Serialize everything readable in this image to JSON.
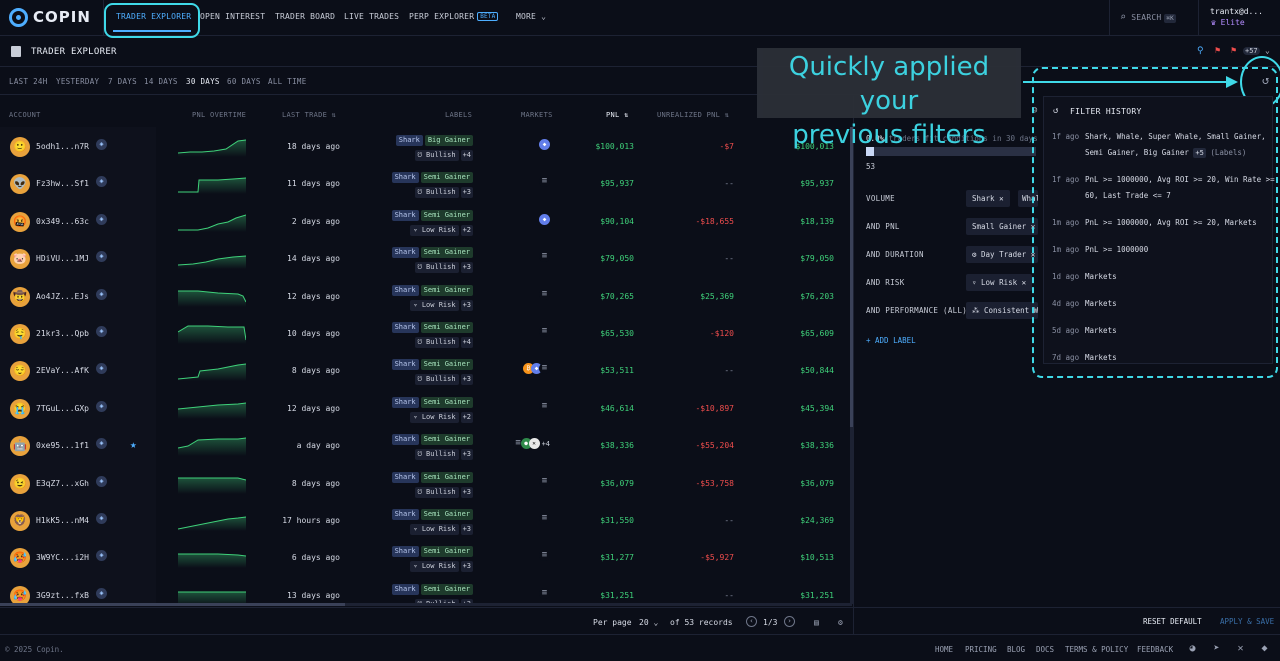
{
  "nav": {
    "logo": "COPIN",
    "items": [
      "TRADER EXPLORER",
      "OPEN INTEREST",
      "TRADER BOARD",
      "LIVE TRADES",
      "PERP EXPLORER"
    ],
    "beta": "BETA",
    "more": "MORE",
    "search": "SEARCH",
    "search_kbd": "⌘K",
    "user": "trantx@d...",
    "tier": "Elite"
  },
  "subheader": {
    "title": "TRADER EXPLORER",
    "count_badge": "+57"
  },
  "timeframes": [
    "LAST 24H",
    "YESTERDAY",
    "7 DAYS",
    "14 DAYS",
    "30 DAYS",
    "60 DAYS",
    "ALL TIME"
  ],
  "active_timeframe": "30 DAYS",
  "columns": {
    "account": "ACCOUNT",
    "pnl_overtime": "PNL OVERTIME",
    "last_trade": "LAST TRADE",
    "labels": "LABELS",
    "markets": "MARKETS",
    "pnl": "PNL",
    "unrealized_pnl": "UNREALIZED PNL"
  },
  "rows": [
    {
      "avatar": "🙂",
      "addr": "5odh1...n7R",
      "last": "18 days ago",
      "l1": [
        "Shark",
        "Big Gainer"
      ],
      "l2": [
        "Bullish"
      ],
      "plus": "+4",
      "markets": [
        "eth"
      ],
      "pnl": "$100,013",
      "upnl": "-$7",
      "upnl_cls": "neg",
      "total": "$100,013",
      "spark": "0,18 12,17 24,17 36,16 48,14 60,6 68,5"
    },
    {
      "avatar": "👽",
      "addr": "Fz3hw...Sf1",
      "last": "11 days ago",
      "l1": [
        "Shark",
        "Semi Gainer"
      ],
      "l2": [
        "Bullish"
      ],
      "plus": "+3",
      "markets": [
        "list"
      ],
      "pnl": "$95,937",
      "upnl": "--",
      "upnl_cls": "neu",
      "total": "$95,937",
      "spark": "0,20 20,20 21,8 40,8 55,7 68,6"
    },
    {
      "avatar": "🤬",
      "addr": "0x349...63c",
      "last": "2 days ago",
      "l1": [
        "Shark",
        "Semi Gainer"
      ],
      "l2": [
        "Low Risk"
      ],
      "plus": "+2",
      "markets": [
        "eth"
      ],
      "pnl": "$90,104",
      "upnl": "-$18,655",
      "upnl_cls": "neg",
      "total": "$18,139",
      "spark": "0,20 20,20 30,18 40,14 50,12 58,8 68,5"
    },
    {
      "avatar": "🐷",
      "addr": "HDiVU...1MJ",
      "last": "14 days ago",
      "l1": [
        "Shark",
        "Semi Gainer"
      ],
      "l2": [
        "Bullish"
      ],
      "plus": "+3",
      "markets": [
        "list"
      ],
      "pnl": "$79,050",
      "upnl": "--",
      "upnl_cls": "neu",
      "total": "$79,050",
      "spark": "0,18 15,17 28,15 40,12 55,10 68,9"
    },
    {
      "avatar": "🤠",
      "addr": "Ao4JZ...EJs",
      "last": "12 days ago",
      "l1": [
        "Shark",
        "Semi Gainer"
      ],
      "l2": [
        "Low Risk"
      ],
      "plus": "+3",
      "markets": [
        "list"
      ],
      "pnl": "$70,265",
      "upnl": "$25,369",
      "upnl_cls": "pos",
      "total": "$76,203",
      "spark": "0,6 20,6 40,8 60,9 65,11 68,17"
    },
    {
      "avatar": "🤤",
      "addr": "21kr3...Qpb",
      "last": "10 days ago",
      "l1": [
        "Shark",
        "Semi Gainer"
      ],
      "l2": [
        "Bullish"
      ],
      "plus": "+4",
      "markets": [
        "list"
      ],
      "pnl": "$65,530",
      "upnl": "-$120",
      "upnl_cls": "neg",
      "total": "$65,609",
      "spark": "0,10 10,4 30,4 50,5 66,5 68,18"
    },
    {
      "avatar": "😌",
      "addr": "2EVaY...AfK",
      "last": "8 days ago",
      "l1": [
        "Shark",
        "Semi Gainer"
      ],
      "l2": [
        "Bullish"
      ],
      "plus": "+3",
      "markets": [
        "btc",
        "eth",
        "list"
      ],
      "pnl": "$53,511",
      "upnl": "--",
      "upnl_cls": "neu",
      "total": "$50,844",
      "spark": "0,20 20,18 22,12 40,10 50,8 60,6 68,5"
    },
    {
      "avatar": "😭",
      "addr": "7TGuL...GXp",
      "last": "12 days ago",
      "l1": [
        "Shark",
        "Semi Gainer"
      ],
      "l2": [
        "Low Risk"
      ],
      "plus": "+2",
      "markets": [
        "list"
      ],
      "pnl": "$46,614",
      "upnl": "-$10,897",
      "upnl_cls": "neg",
      "total": "$45,394",
      "spark": "0,12 20,10 40,8 60,7 68,6"
    },
    {
      "avatar": "🤖",
      "addr": "0xe95...1f1",
      "last": "a day ago",
      "l1": [
        "Shark",
        "Semi Gainer"
      ],
      "l2": [
        "Bullish"
      ],
      "plus": "+3",
      "markets": [
        "list",
        "gr",
        "x"
      ],
      "mplus": "+4",
      "pnl": "$38,336",
      "upnl": "-$55,204",
      "upnl_cls": "neg",
      "total": "$38,336",
      "star": true,
      "spark": "0,14 10,12 20,6 40,5 60,5 68,4"
    },
    {
      "avatar": "😉",
      "addr": "E3qZ7...xGh",
      "last": "8 days ago",
      "l1": [
        "Shark",
        "Semi Gainer"
      ],
      "l2": [
        "Bullish"
      ],
      "plus": "+3",
      "markets": [
        "list"
      ],
      "pnl": "$36,079",
      "upnl": "-$53,758",
      "upnl_cls": "neg",
      "total": "$36,079",
      "spark": "0,6 20,6 40,6 60,6 68,8"
    },
    {
      "avatar": "🦁",
      "addr": "H1kK5...nM4",
      "last": "17 hours ago",
      "l1": [
        "Shark",
        "Semi Gainer"
      ],
      "l2": [
        "Low Risk"
      ],
      "plus": "+3",
      "markets": [
        "list"
      ],
      "pnl": "$31,550",
      "upnl": "--",
      "upnl_cls": "neu",
      "total": "$24,369",
      "spark": "0,20 10,18 20,16 30,14 40,12 50,10 60,9 68,8"
    },
    {
      "avatar": "🥵",
      "addr": "3W9YC...i2H",
      "last": "6 days ago",
      "l1": [
        "Shark",
        "Semi Gainer"
      ],
      "l2": [
        "Low Risk"
      ],
      "plus": "+3",
      "markets": [
        "list"
      ],
      "pnl": "$31,277",
      "upnl": "-$5,927",
      "upnl_cls": "neg",
      "total": "$10,513",
      "spark": "0,8 20,8 40,8 60,9 68,10"
    },
    {
      "avatar": "🥵",
      "addr": "3G9zt...fxB",
      "last": "13 days ago",
      "l1": [
        "Shark",
        "Semi Gainer"
      ],
      "l2": [
        "Bullish"
      ],
      "plus": "+3",
      "markets": [
        "list"
      ],
      "pnl": "$31,251",
      "upnl": "--",
      "upnl_cls": "neu",
      "total": "$31,251",
      "spark": "0,8 20,8 40,8 60,8 68,8"
    }
  ],
  "pager": {
    "per_page": "Per page",
    "size": "20",
    "records": "of 53 records",
    "page": "1/3"
  },
  "filters": {
    "fit_pct": "0.0%",
    "fit_text": "traders fit conditions in 30 days",
    "count": "53",
    "rows": [
      {
        "label": "VOLUME",
        "chips": [
          "Shark",
          "Whale"
        ]
      },
      {
        "label": "AND PNL",
        "chips": [
          "Small Gainer"
        ]
      },
      {
        "label": "AND DURATION",
        "chips": [
          "Day Trader"
        ]
      },
      {
        "label": "AND RISK",
        "chips": [
          "Low Risk"
        ]
      },
      {
        "label": "AND PERFORMANCE (ALL)",
        "chips": [
          "Consistent Win"
        ]
      }
    ],
    "add_label": "ADD LABEL",
    "reset": "RESET DEFAULT",
    "apply": "APPLY & SAVE"
  },
  "tooltip": {
    "line1": "Quickly applied your",
    "line2": "previous filters"
  },
  "history": {
    "title": "FILTER HISTORY",
    "items": [
      {
        "age": "1f ago",
        "text": "Shark, Whale, Super Whale, Small Gainer, Semi Gainer, Big Gainer",
        "badge": "+5",
        "suffix": "(Labels)"
      },
      {
        "age": "1f ago",
        "text": "PnL >= 1000000, Avg ROI >= 20, Win Rate >= 60, Last Trade <= 7"
      },
      {
        "age": "1m ago",
        "text": "PnL >= 1000000, Avg ROI >= 20, Markets"
      },
      {
        "age": "1m ago",
        "text": "PnL >= 1000000"
      },
      {
        "age": "1d ago",
        "text": "Markets"
      },
      {
        "age": "4d ago",
        "text": "Markets"
      },
      {
        "age": "5d ago",
        "text": "Markets"
      },
      {
        "age": "7d ago",
        "text": "Markets"
      }
    ]
  },
  "footer": {
    "copyright": "© 2025 Copin.",
    "links": [
      "HOME",
      "PRICING",
      "BLOG",
      "DOCS",
      "TERMS & POLICY",
      "FEEDBACK"
    ]
  },
  "colors": {
    "accent": "#4eaeff",
    "highlight": "#3fd9e8",
    "positive": "#3fd17a",
    "negative": "#ef4d4d",
    "tier": "#b48cff"
  }
}
